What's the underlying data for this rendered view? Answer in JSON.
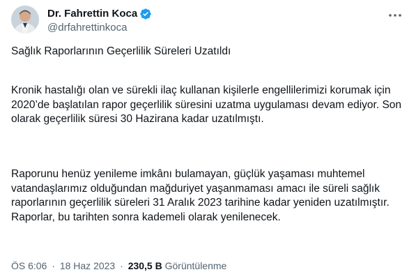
{
  "author": {
    "display_name": "Dr. Fahrettin Koca",
    "handle": "@drfahrettinkoca",
    "verified_icon": "verified-badge-icon"
  },
  "tweet": {
    "title": "Sağlık Raporlarının Geçerlilik Süreleri Uzatıldı",
    "paragraph_1": "Kronik hastalığı olan ve sürekli ilaç kullanan kişilerle engellilerimizi korumak için 2020’de başlatılan rapor geçerlilik süresini uzatma uygulaması devam ediyor. Son olarak geçerlilik süresi 30 Hazirana kadar uzatılmıştı.",
    "paragraph_2": "Raporunu henüz yenileme imkânı bulamayan, güçlük yaşaması muhtemel vatandaşlarımız olduğundan mağduriyet yaşanmaması amacı ile süreli sağlık raporlarının geçerlilik süreleri 31 Aralık 2023 tarihine kadar yeniden uzatılmıştır. Raporlar, bu tarihten sonra kademeli olarak yenilenecek."
  },
  "meta": {
    "time": "ÖS 6:06",
    "separator": "·",
    "date": "18 Haz 2023",
    "views_count": "230,5 B",
    "views_label": "Görüntülenme"
  },
  "colors": {
    "verified": "#1d9bf0",
    "muted": "#536471",
    "text": "#0f1419"
  }
}
